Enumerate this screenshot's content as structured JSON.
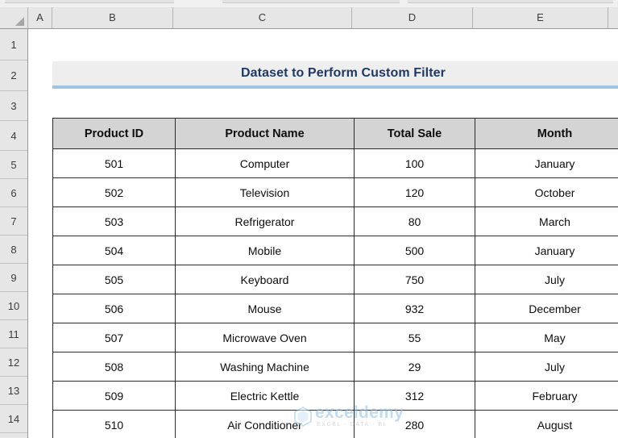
{
  "app": {
    "type": "spreadsheet",
    "column_headers": [
      "A",
      "B",
      "C",
      "D",
      "E"
    ],
    "row_headers": [
      "1",
      "2",
      "3",
      "4",
      "5",
      "6",
      "7",
      "8",
      "9",
      "10",
      "11",
      "12",
      "13",
      "14"
    ]
  },
  "title_banner": {
    "text": "Dataset to Perform Custom Filter",
    "text_color": "#1f3864",
    "background": "#eeeeee",
    "accent_color": "#9dc3e6"
  },
  "table": {
    "headers": [
      "Product ID",
      "Product Name",
      "Total Sale",
      "Month"
    ],
    "header_background": "#d4d4d4",
    "border_color": "#2b2b2b",
    "rows": [
      {
        "product_id": "501",
        "product_name": "Computer",
        "total_sale": "100",
        "month": "January"
      },
      {
        "product_id": "502",
        "product_name": "Television",
        "total_sale": "120",
        "month": "October"
      },
      {
        "product_id": "503",
        "product_name": "Refrigerator",
        "total_sale": "80",
        "month": "March"
      },
      {
        "product_id": "504",
        "product_name": "Mobile",
        "total_sale": "500",
        "month": "January"
      },
      {
        "product_id": "505",
        "product_name": "Keyboard",
        "total_sale": "750",
        "month": "July"
      },
      {
        "product_id": "506",
        "product_name": "Mouse",
        "total_sale": "932",
        "month": "December"
      },
      {
        "product_id": "507",
        "product_name": "Microwave Oven",
        "total_sale": "55",
        "month": "May"
      },
      {
        "product_id": "508",
        "product_name": "Washing Machine",
        "total_sale": "29",
        "month": "July"
      },
      {
        "product_id": "509",
        "product_name": "Electric Kettle",
        "total_sale": "312",
        "month": "February"
      },
      {
        "product_id": "510",
        "product_name": "Air Conditioner",
        "total_sale": "280",
        "month": "August"
      }
    ]
  },
  "watermark": {
    "name": "exceldemy",
    "tagline": "EXCEL - DATA - BI",
    "color": "#8fc0e8"
  }
}
